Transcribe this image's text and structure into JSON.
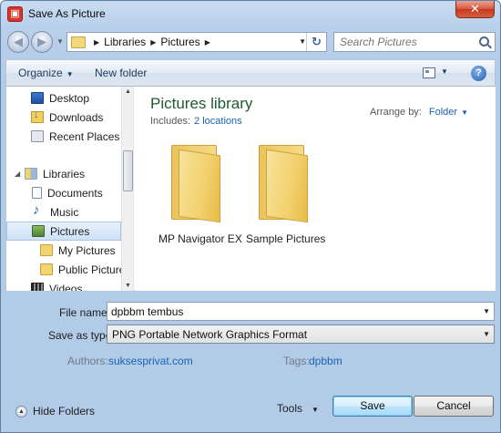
{
  "window": {
    "title": "Save As Picture",
    "close": "✕",
    "app_icon": "picture-app-icon"
  },
  "nav": {
    "back": "◀",
    "forward": "▶",
    "recent": "▼",
    "breadcrumb": [
      "Libraries",
      "Pictures"
    ],
    "refresh": "↻"
  },
  "search": {
    "placeholder": "Search Pictures"
  },
  "toolbar": {
    "organize": "Organize",
    "new_folder": "New folder",
    "help": "?"
  },
  "sidebar": {
    "items": [
      {
        "label": "Desktop",
        "icon": "desktop-icon"
      },
      {
        "label": "Downloads",
        "icon": "downloads-icon"
      },
      {
        "label": "Recent Places",
        "icon": "recent-places-icon"
      },
      {
        "label": "Libraries",
        "icon": "libraries-icon"
      },
      {
        "label": "Documents",
        "icon": "documents-icon"
      },
      {
        "label": "Music",
        "icon": "music-icon"
      },
      {
        "label": "Pictures",
        "icon": "pictures-icon",
        "selected": true
      },
      {
        "label": "My Pictures",
        "icon": "folder-icon"
      },
      {
        "label": "Public Pictures",
        "icon": "folder-icon"
      },
      {
        "label": "Videos",
        "icon": "videos-icon"
      }
    ]
  },
  "library": {
    "title": "Pictures library",
    "includes_label": "Includes:",
    "includes_link": "2 locations",
    "arrange_label": "Arrange by:",
    "arrange_value": "Folder",
    "folders": [
      "MP Navigator EX",
      "Sample Pictures"
    ]
  },
  "form": {
    "file_name_label": "File name:",
    "file_name_value": "dpbbm tembus",
    "save_type_label": "Save as type:",
    "save_type_value": "PNG Portable Network Graphics Format",
    "authors_label": "Authors:",
    "authors_value": "suksesprivat.com",
    "tags_label": "Tags:",
    "tags_value": "dpbbm"
  },
  "footer": {
    "hide_folders": "Hide Folders",
    "tools": "Tools",
    "save": "Save",
    "cancel": "Cancel"
  },
  "colors": {
    "accent_link": "#1a62b6",
    "library_title": "#1e5a30",
    "selected_bg": "#cfe1f6"
  }
}
